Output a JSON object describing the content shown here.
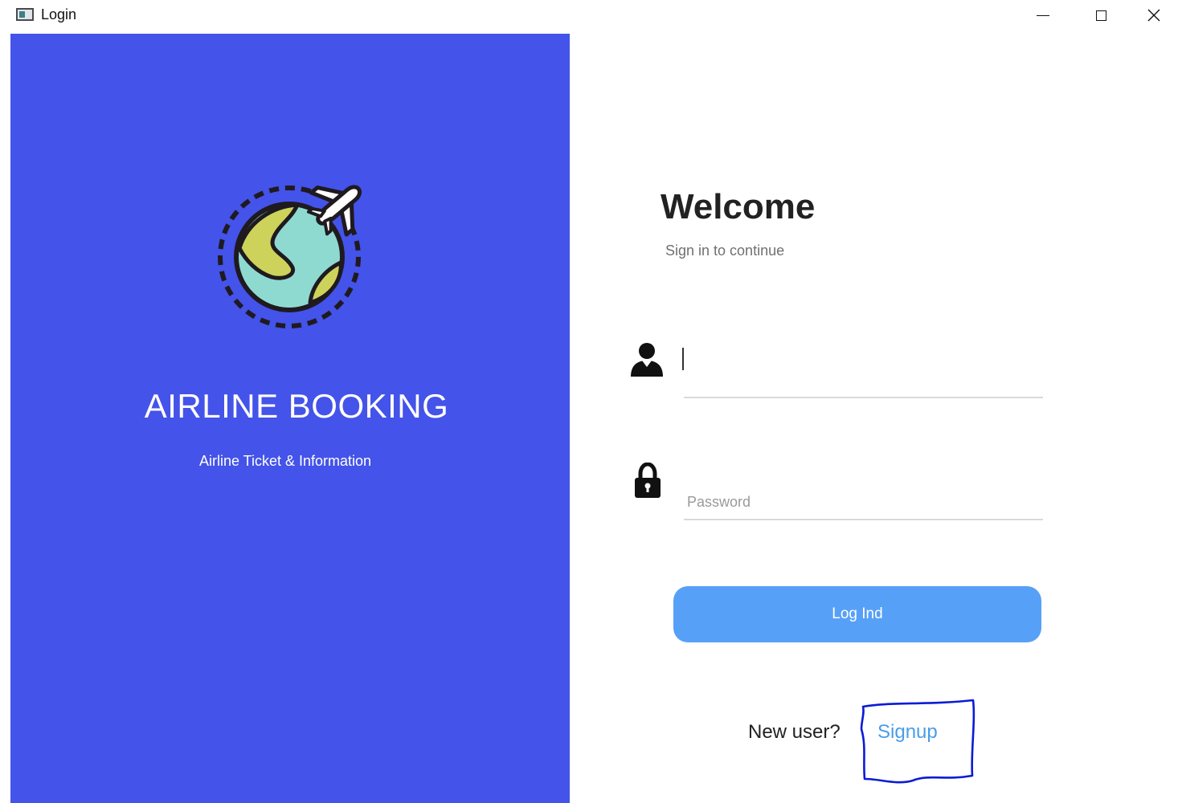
{
  "window": {
    "title": "Login",
    "controls": [
      "minimize",
      "maximize",
      "close"
    ]
  },
  "left_panel": {
    "background_color": "#4453e9",
    "logo_icon": "globe-airplane-icon",
    "title": "AIRLINE BOOKING",
    "subtitle": "Airline Ticket & Information"
  },
  "form": {
    "heading": "Welcome",
    "subheading": "Sign in to continue",
    "username": {
      "icon": "user-icon",
      "value": "",
      "placeholder": ""
    },
    "password": {
      "icon": "lock-icon",
      "value": "",
      "placeholder": "Password"
    },
    "login_button_label": "Log Ind",
    "login_button_color": "#57a0f7",
    "new_user_prompt": "New user?",
    "signup_link_label": "Signup",
    "signup_link_color": "#4a9de9"
  },
  "annotation": {
    "shape": "hand-drawn box around signup link",
    "color": "#0a1bd6"
  }
}
